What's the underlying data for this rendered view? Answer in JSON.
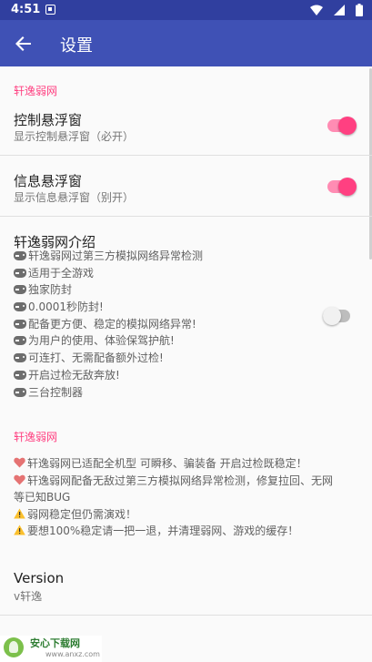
{
  "status_bar": {
    "time": "4:51"
  },
  "app_bar": {
    "title": "设置"
  },
  "section1": {
    "header": "轩逸弱网",
    "items": [
      {
        "title": "控制悬浮窗",
        "summary": "显示控制悬浮窗（必开）",
        "checked": true
      },
      {
        "title": "信息悬浮窗",
        "summary": "显示信息悬浮窗（别开）",
        "checked": true
      }
    ],
    "intro": {
      "title": "轩逸弱网介绍",
      "checked": false,
      "lines": [
        "轩逸弱网过第三方模拟网络异常检测",
        "适用于全游戏",
        "独家防封",
        "0.0001秒防封!",
        "配备更方便、稳定的模拟网络异常!",
        "为用户的使用、体验保驾护航!",
        "可连打、无需配备额外过检!",
        "开启过检无敌奔放!",
        "三台控制器"
      ]
    }
  },
  "section2": {
    "header": "轩逸弱网",
    "notes": [
      "轩逸弱网已适配全机型 可瞬移、骗装备 开启过检既稳定！",
      "轩逸弱网配备无敌过第三方模拟网络异常检测，修复拉回、无网",
      "等已知BUG",
      "弱网稳定但仍需演戏！",
      "要想100%稳定请一把一退，并清理弱网、游戏的缓存！"
    ],
    "version_title": "Version",
    "version_value": "v轩逸"
  },
  "watermark": {
    "name": "安心下载网",
    "url": "www.anxz.com"
  },
  "colors": {
    "primary": "#3f51b5",
    "primary_dark": "#303f9f",
    "accent": "#ff4081"
  },
  "icons": {
    "back": "arrow-back-icon",
    "gamepad": "gamepad-icon",
    "heart": "heart-icon",
    "warning": "warning-icon"
  }
}
